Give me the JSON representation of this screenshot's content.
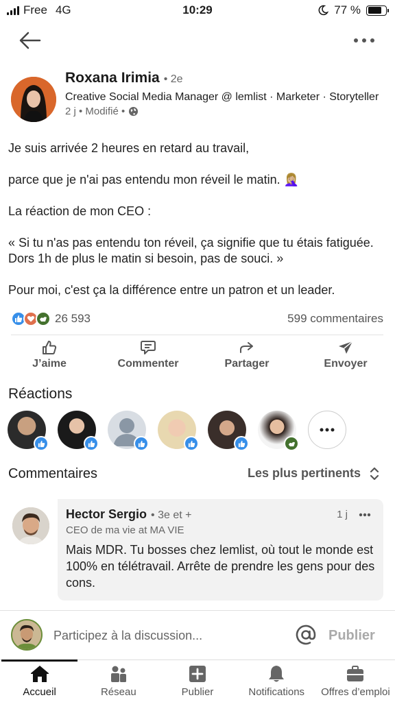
{
  "status_bar": {
    "carrier": "Free",
    "network": "4G",
    "time": "10:29",
    "battery": "77 %",
    "battery_level": 0.77
  },
  "post": {
    "author": {
      "name": "Roxana Irimia",
      "degree": "• 2e",
      "headline": "Creative Social Media Manager @ lemlist · Marketer · Storyteller",
      "meta": "2 j • Modifié •"
    },
    "body": [
      "Je suis arrivée 2 heures en retard au travail,",
      "parce que je n'ai pas entendu mon réveil le matin. 🤦🏼‍♀️",
      "La réaction de mon CEO :",
      "« Si tu n'as pas entendu ton réveil, ça signifie que tu étais fatiguée. Dors 1h de plus le matin si besoin, pas de souci. »",
      "Pour moi, c'est ça la différence entre un patron et un leader."
    ],
    "reaction_count": "26 593",
    "comments_count": "599 commentaires"
  },
  "actions": {
    "like": "J’aime",
    "comment": "Commenter",
    "share": "Partager",
    "send": "Envoyer"
  },
  "reactions": {
    "title": "Réactions"
  },
  "comments": {
    "title": "Commentaires",
    "sort_label": "Les plus pertinents",
    "items": [
      {
        "name": "Hector Sergio",
        "degree": "• 3e et +",
        "time": "1 j",
        "headline": "CEO de ma vie at MA VIE",
        "text": "Mais MDR. Tu bosses chez lemlist, où tout le monde est 100% en télétravail. Arrête de prendre les gens pour des cons."
      }
    ]
  },
  "composer": {
    "placeholder": "Participez à la discussion...",
    "publish_label": "Publier"
  },
  "tabs": [
    {
      "label": "Accueil",
      "icon": "home-icon",
      "active": true
    },
    {
      "label": "Réseau",
      "icon": "network-icon"
    },
    {
      "label": "Publier",
      "icon": "post-icon"
    },
    {
      "label": "Notifications",
      "icon": "bell-icon"
    },
    {
      "label": "Offres d’emploi",
      "icon": "briefcase-icon"
    }
  ],
  "colors": {
    "like_blue": "#378fe9",
    "love_red": "#df704d",
    "support_green": "#44712e",
    "text": "#1d1d1d",
    "muted": "#666666"
  }
}
